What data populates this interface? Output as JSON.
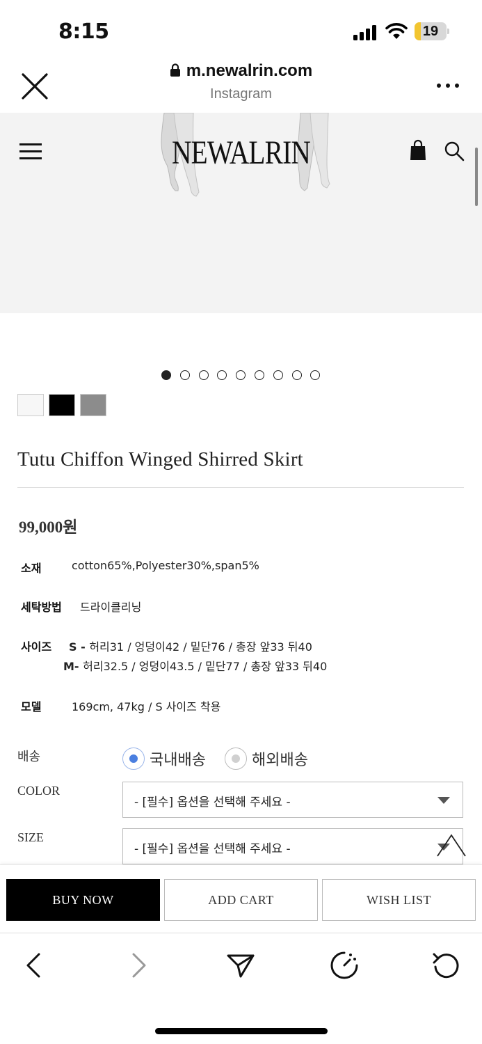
{
  "status_bar": {
    "time": "8:15",
    "battery": "19",
    "battery_level": 0.19,
    "battery_color": "#f2c530"
  },
  "browser": {
    "url": "m.newalrin.com",
    "source": "Instagram",
    "icons": [
      "close-icon",
      "lock-icon",
      "more-icon"
    ]
  },
  "site_header": {
    "brand": "NEWALRIN",
    "icons": [
      "menu-icon",
      "shopping-bag-icon",
      "search-icon"
    ]
  },
  "carousel": {
    "total": 9,
    "active_index": 0
  },
  "swatches": [
    {
      "name": "white",
      "color": "#f7f7f7"
    },
    {
      "name": "black",
      "color": "#000000"
    },
    {
      "name": "gray",
      "color": "#8c8c8c"
    }
  ],
  "product": {
    "title": "Tutu Chiffon Winged Shirred Skirt",
    "price": "99,000원"
  },
  "specs": {
    "material": {
      "label": "소재",
      "value": "cotton65%,Polyester30%,span5%"
    },
    "washing": {
      "label": "세탁방법",
      "value": "드라이클리닝"
    },
    "size": {
      "label": "사이즈",
      "s_key": "S - ",
      "s_value": "허리31 / 엉덩이42  / 밑단76  / 총장 앞33 뒤40",
      "m_key": "M- ",
      "m_value": " 허리32.5 / 엉덩이43.5  / 밑단77  / 총장 앞33 뒤40"
    },
    "model": {
      "label": "모델",
      "value": "169cm, 47kg  /  S 사이즈 착용"
    }
  },
  "options": {
    "shipping_label": "배송",
    "shipping_domestic": "국내배송",
    "shipping_overseas": "해외배송",
    "shipping_selected": "domestic",
    "color_label": "COLOR",
    "color_value": "- [필수] 옵션을 선택해 주세요 -",
    "size_label": "SIZE",
    "size_value": "- [필수] 옵션을 선택해 주세요 -"
  },
  "actions": {
    "buy_now": "BUY NOW",
    "add_cart": "ADD CART",
    "wish_list": "WISH LIST"
  },
  "browser_nav": {
    "icons": [
      "back-icon",
      "forward-icon",
      "share-icon",
      "speed-icon",
      "reload-icon"
    ]
  },
  "colors": {
    "accent_radio": "#4a7fe0",
    "hero_bg": "#f3f3f3"
  }
}
